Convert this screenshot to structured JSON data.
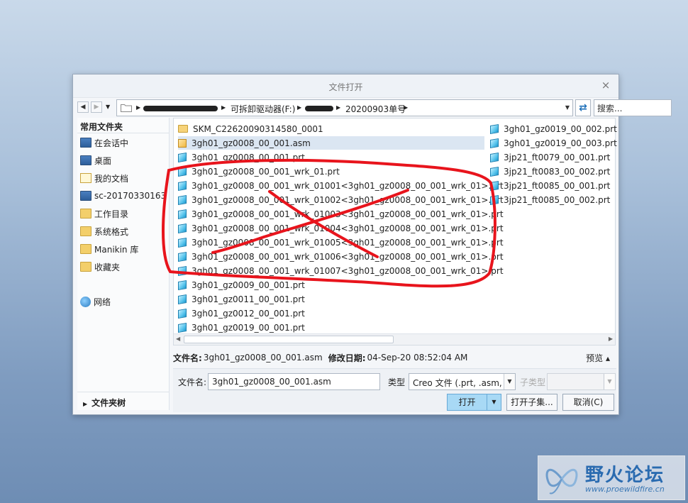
{
  "dialog": {
    "title": "文件打开",
    "close": "×"
  },
  "nav": {
    "path": [
      "可拆卸驱动器(F:)",
      "20200903单号"
    ],
    "search_placeholder": "搜索..."
  },
  "sidebar": {
    "header": "常用文件夹",
    "items": [
      {
        "label": "在会话中",
        "icon": "monitor-icon"
      },
      {
        "label": "桌面",
        "icon": "desktop-icon"
      },
      {
        "label": "我的文档",
        "icon": "documents-icon"
      },
      {
        "label": "sc-20170330163",
        "icon": "computer-icon"
      },
      {
        "label": "工作目录",
        "icon": "working-folder-icon"
      },
      {
        "label": "系统格式",
        "icon": "system-format-folder-icon"
      },
      {
        "label": "Manikin 库",
        "icon": "manikin-library-icon"
      },
      {
        "label": "收藏夹",
        "icon": "favorites-icon"
      },
      {
        "label": "网络",
        "icon": "network-icon"
      }
    ],
    "footer": "文件夹树"
  },
  "files": {
    "col1": [
      {
        "name": "SKM_C22620090314580_0001",
        "type": "folder"
      },
      {
        "name": "3gh01_gz0008_00_001.asm",
        "type": "asm",
        "selected": true
      },
      {
        "name": "3gh01_gz0008_00_001.prt",
        "type": "prt"
      },
      {
        "name": "3gh01_gz0008_00_001_wrk_01.prt",
        "type": "prt"
      },
      {
        "name": "3gh01_gz0008_00_001_wrk_01001<3gh01_gz0008_00_001_wrk_01>.prt",
        "type": "prt"
      },
      {
        "name": "3gh01_gz0008_00_001_wrk_01002<3gh01_gz0008_00_001_wrk_01>.prt",
        "type": "prt"
      },
      {
        "name": "3gh01_gz0008_00_001_wrk_01003<3gh01_gz0008_00_001_wrk_01>.prt",
        "type": "prt"
      },
      {
        "name": "3gh01_gz0008_00_001_wrk_01004<3gh01_gz0008_00_001_wrk_01>.prt",
        "type": "prt"
      },
      {
        "name": "3gh01_gz0008_00_001_wrk_01005<3gh01_gz0008_00_001_wrk_01>.prt",
        "type": "prt"
      },
      {
        "name": "3gh01_gz0008_00_001_wrk_01006<3gh01_gz0008_00_001_wrk_01>.prt",
        "type": "prt"
      },
      {
        "name": "3gh01_gz0008_00_001_wrk_01007<3gh01_gz0008_00_001_wrk_01>.prt",
        "type": "prt"
      },
      {
        "name": "3gh01_gz0009_00_001.prt",
        "type": "prt"
      },
      {
        "name": "3gh01_gz0011_00_001.prt",
        "type": "prt"
      },
      {
        "name": "3gh01_gz0012_00_001.prt",
        "type": "prt"
      },
      {
        "name": "3gh01_gz0019_00_001.prt",
        "type": "prt"
      }
    ],
    "col2": [
      {
        "name": "3gh01_gz0019_00_002.prt",
        "type": "prt"
      },
      {
        "name": "3gh01_gz0019_00_003.prt",
        "type": "prt"
      },
      {
        "name": "3jp21_ft0079_00_001.prt",
        "type": "prt"
      },
      {
        "name": "3jp21_ft0083_00_002.prt",
        "type": "prt"
      },
      {
        "name": "3jp21_ft0085_00_001.prt",
        "type": "prt"
      },
      {
        "name": "3jp21_ft0085_00_002.prt",
        "type": "prt"
      }
    ]
  },
  "info": {
    "filename_label": "文件名:",
    "filename_value": "3gh01_gz0008_00_001.asm",
    "modified_label": "修改日期:",
    "modified_value": "04-Sep-20 08:52:04 AM",
    "preview": "预览 ▴"
  },
  "form": {
    "filename_label": "文件名:",
    "filename_value": "3gh01_gz0008_00_001.asm",
    "type_label": "类型",
    "type_value": "Creo 文件 (.prt, .asm,",
    "subtype_label": "子类型",
    "open_button": "打开",
    "open_sub_button": "打开子集...",
    "cancel_button": "取消(C)"
  },
  "watermark": {
    "title": "野火论坛",
    "url": "www.proewildfire.cn"
  },
  "colors": {
    "annotation_red": "#e8141c",
    "accent_blue": "#a8d9f5"
  }
}
